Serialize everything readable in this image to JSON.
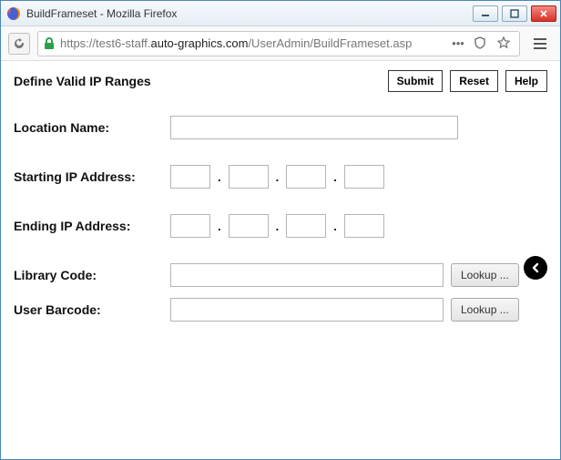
{
  "window": {
    "title": "BuildFrameset - Mozilla Firefox"
  },
  "address": {
    "url_prefix": "https://test6-staff.",
    "url_host": "auto-graphics.com",
    "url_path": "/UserAdmin/BuildFrameset.asp"
  },
  "page": {
    "title": "Define Valid IP Ranges",
    "buttons": {
      "submit": "Submit",
      "reset": "Reset",
      "help": "Help"
    }
  },
  "form": {
    "location_label": "Location Name:",
    "start_ip_label": "Starting IP Address:",
    "end_ip_label": "Ending IP Address:",
    "library_label": "Library Code:",
    "barcode_label": "User Barcode:",
    "lookup_label": "Lookup ..."
  }
}
